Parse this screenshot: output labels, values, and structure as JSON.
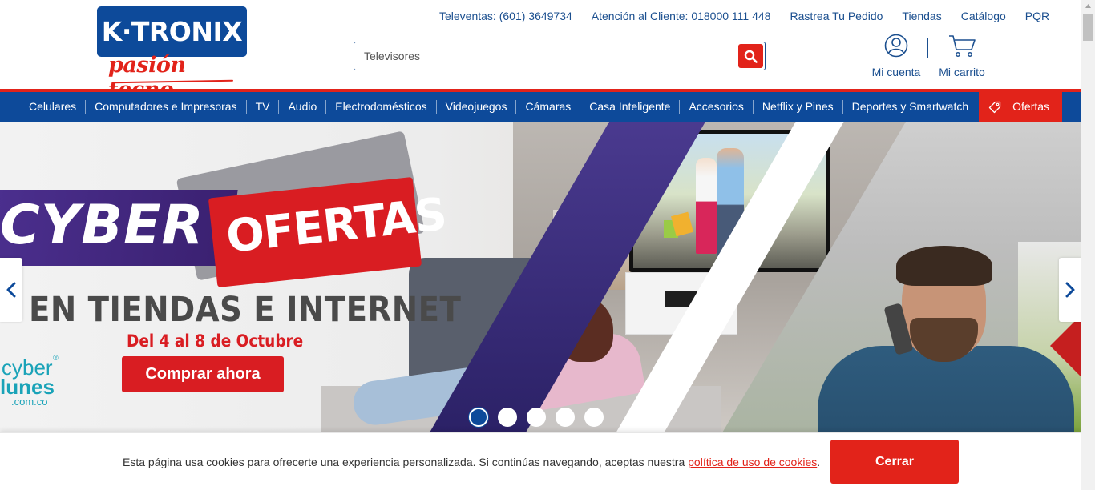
{
  "brand": {
    "logo_text": "K·TRONIX",
    "tagline": "pasión tecno",
    "primary_color": "#0d4a9a",
    "accent_color": "#e2231a"
  },
  "top_links": [
    {
      "label": "Televentas: (601) 3649734"
    },
    {
      "label": "Atención al Cliente: 018000 111 448"
    },
    {
      "label": "Rastrea Tu Pedido"
    },
    {
      "label": "Tiendas"
    },
    {
      "label": "Catálogo"
    },
    {
      "label": "PQR"
    }
  ],
  "search": {
    "value": "Televisores",
    "icon": "search-icon"
  },
  "account": {
    "label": "Mi cuenta",
    "icon": "user-icon"
  },
  "cart": {
    "label": "Mi carrito",
    "icon": "cart-icon"
  },
  "nav": {
    "items": [
      {
        "label": "Celulares"
      },
      {
        "label": "Computadores e Impresoras"
      },
      {
        "label": "TV"
      },
      {
        "label": "Audio"
      },
      {
        "label": "Electrodomésticos"
      },
      {
        "label": "Videojuegos"
      },
      {
        "label": "Cámaras"
      },
      {
        "label": "Casa Inteligente"
      },
      {
        "label": "Accesorios"
      },
      {
        "label": "Netflix y Pines"
      },
      {
        "label": "Deportes y Smartwatch"
      }
    ],
    "ofertas_label": "Ofertas",
    "ofertas_icon": "tag-icon"
  },
  "banner": {
    "headline_1": "CYBER",
    "headline_2": "OFERTAS",
    "subheadline": "EN TIENDAS E INTERNET",
    "date_text": "Del 4 al 8 de Octubre",
    "cta_label": "Comprar ahora",
    "cyberlunes": {
      "line1": "cyber",
      "line2": "lunes",
      "line3": ".com.co",
      "registered": "®"
    },
    "slides_total": 5,
    "active_slide": 1
  },
  "cookie": {
    "text": "Esta página usa cookies para ofrecerte una experiencia personalizada. Si continúas navegando, aceptas nuestra",
    "link_text": "política de uso de cookies",
    "suffix": ".",
    "button_label": "Cerrar"
  }
}
